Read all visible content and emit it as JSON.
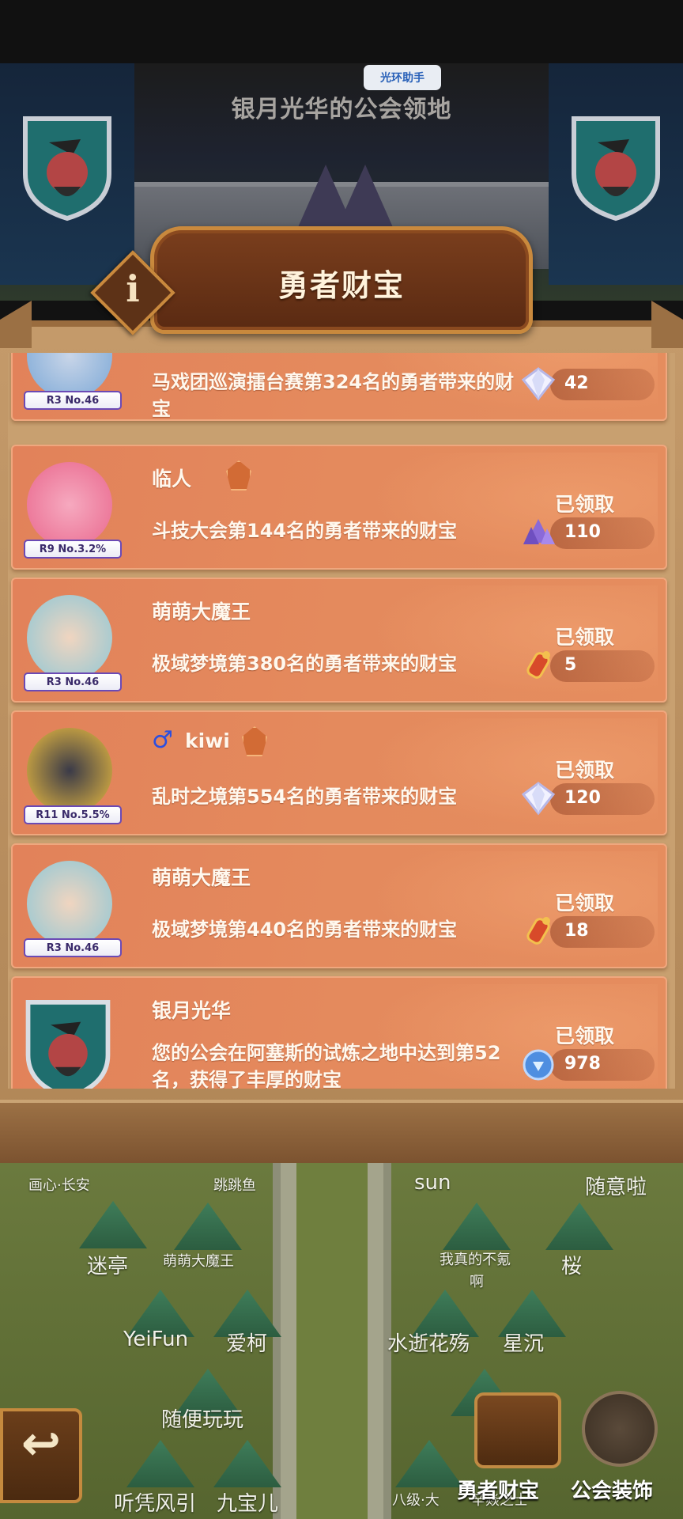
{
  "header": {
    "assistant_label": "光环助手",
    "guild_title": "银月光华的公会领地"
  },
  "dialog": {
    "title": "勇者财宝",
    "info_label": "i"
  },
  "entries": [
    {
      "name": "",
      "rank": "R3 No.46",
      "description": "马戏团巡演擂台赛第324名的勇者带来的财宝",
      "status": "",
      "reward_icon": "diamond-icon",
      "reward_count": "42"
    },
    {
      "name": "临人",
      "rank": "R9 No.3.2%",
      "description": "斗技大会第144名的勇者带来的财宝",
      "status": "已领取",
      "reward_icon": "purple-crystal-icon",
      "reward_count": "110"
    },
    {
      "name": "萌萌大魔王",
      "rank": "R3 No.46",
      "description": "极域梦境第380名的勇者带来的财宝",
      "status": "已领取",
      "reward_icon": "potion-scroll-icon",
      "reward_count": "5"
    },
    {
      "name": "kiwi",
      "gender": "♂",
      "rank": "R11 No.5.5%",
      "description": "乱时之境第554名的勇者带来的财宝",
      "status": "已领取",
      "reward_icon": "diamond-icon",
      "reward_count": "120"
    },
    {
      "name": "萌萌大魔王",
      "rank": "R3 No.46",
      "description": "极域梦境第440名的勇者带来的财宝",
      "status": "已领取",
      "reward_icon": "potion-scroll-icon",
      "reward_count": "18"
    },
    {
      "name": "银月光华",
      "rank": "",
      "description": "您的公会在阿塞斯的试炼之地中达到第52名，获得了丰厚的财宝",
      "status": "已领取",
      "reward_icon": "guild-coin-icon",
      "reward_count": "978"
    }
  ],
  "map": {
    "labels": [
      "画心·长安",
      "跳跳鱼",
      "sun",
      "随意啦",
      "迷亭",
      "萌萌大魔王",
      "我真的不氪",
      "啊",
      "桜",
      "YeiFun",
      "爱柯",
      "水逝花殇",
      "星沉",
      "随便玩玩",
      "听凭风引",
      "九宝儿",
      "八级·大",
      "辛焱之士"
    ],
    "treasure_button": "勇者财宝",
    "guild_decor_button": "公会装饰"
  },
  "colors": {
    "card": "#e48a5d",
    "badge_border": "#6b4ab5",
    "parchment": "#c8a070",
    "frame_gold": "#c9893d"
  }
}
